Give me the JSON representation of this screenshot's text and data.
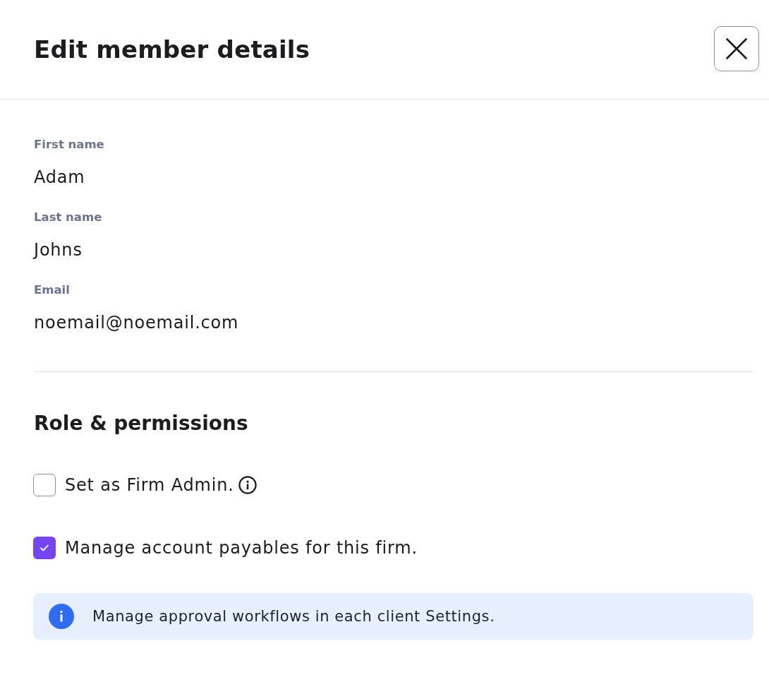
{
  "dialog": {
    "title": "Edit member details"
  },
  "fields": [
    {
      "label": "First name",
      "value": "Adam"
    },
    {
      "label": "Last name",
      "value": "Johns"
    },
    {
      "label": "Email",
      "value": "noemail@noemail.com"
    }
  ],
  "section": {
    "title": "Role & permissions"
  },
  "permissions": [
    {
      "label": "Set as Firm Admin.",
      "checked": false,
      "info": true
    },
    {
      "label": "Manage account payables for this firm.",
      "checked": true,
      "info": false
    }
  ],
  "notice": {
    "text": "Manage approval workflows in each client Settings."
  }
}
